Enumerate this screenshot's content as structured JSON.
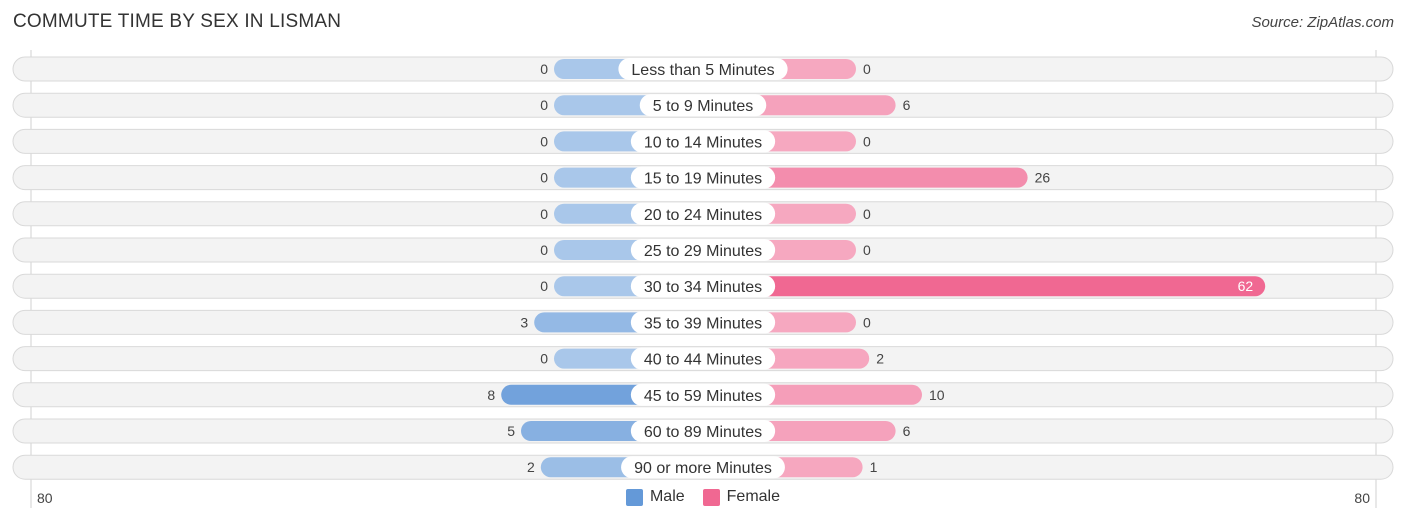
{
  "header": {
    "title": "COMMUTE TIME BY SEX IN LISMAN",
    "source": "Source: ZipAtlas.com"
  },
  "colors": {
    "male": "#a9c7ea",
    "male_strong": "#6499d8",
    "female": "#f6a8c0",
    "female_strong": "#f06892",
    "row_bg": "#f3f3f3"
  },
  "legend": {
    "male_label": "Male",
    "female_label": "Female"
  },
  "axis": {
    "left_label": "80",
    "right_label": "80"
  },
  "chart_data": {
    "type": "bar",
    "orientation": "horizontal-diverging",
    "title": "COMMUTE TIME BY SEX IN LISMAN",
    "categories": [
      "Less than 5 Minutes",
      "5 to 9 Minutes",
      "10 to 14 Minutes",
      "15 to 19 Minutes",
      "20 to 24 Minutes",
      "25 to 29 Minutes",
      "30 to 34 Minutes",
      "35 to 39 Minutes",
      "40 to 44 Minutes",
      "45 to 59 Minutes",
      "60 to 89 Minutes",
      "90 or more Minutes"
    ],
    "series": [
      {
        "name": "Male",
        "values": [
          0,
          0,
          0,
          0,
          0,
          0,
          0,
          3,
          0,
          8,
          5,
          2
        ]
      },
      {
        "name": "Female",
        "values": [
          0,
          6,
          0,
          26,
          0,
          0,
          62,
          0,
          2,
          10,
          6,
          1
        ]
      }
    ],
    "xlim": [
      -80,
      80
    ],
    "axis_tick_labels": [
      "80",
      "80"
    ],
    "legend_position": "bottom-center",
    "grid": false
  }
}
